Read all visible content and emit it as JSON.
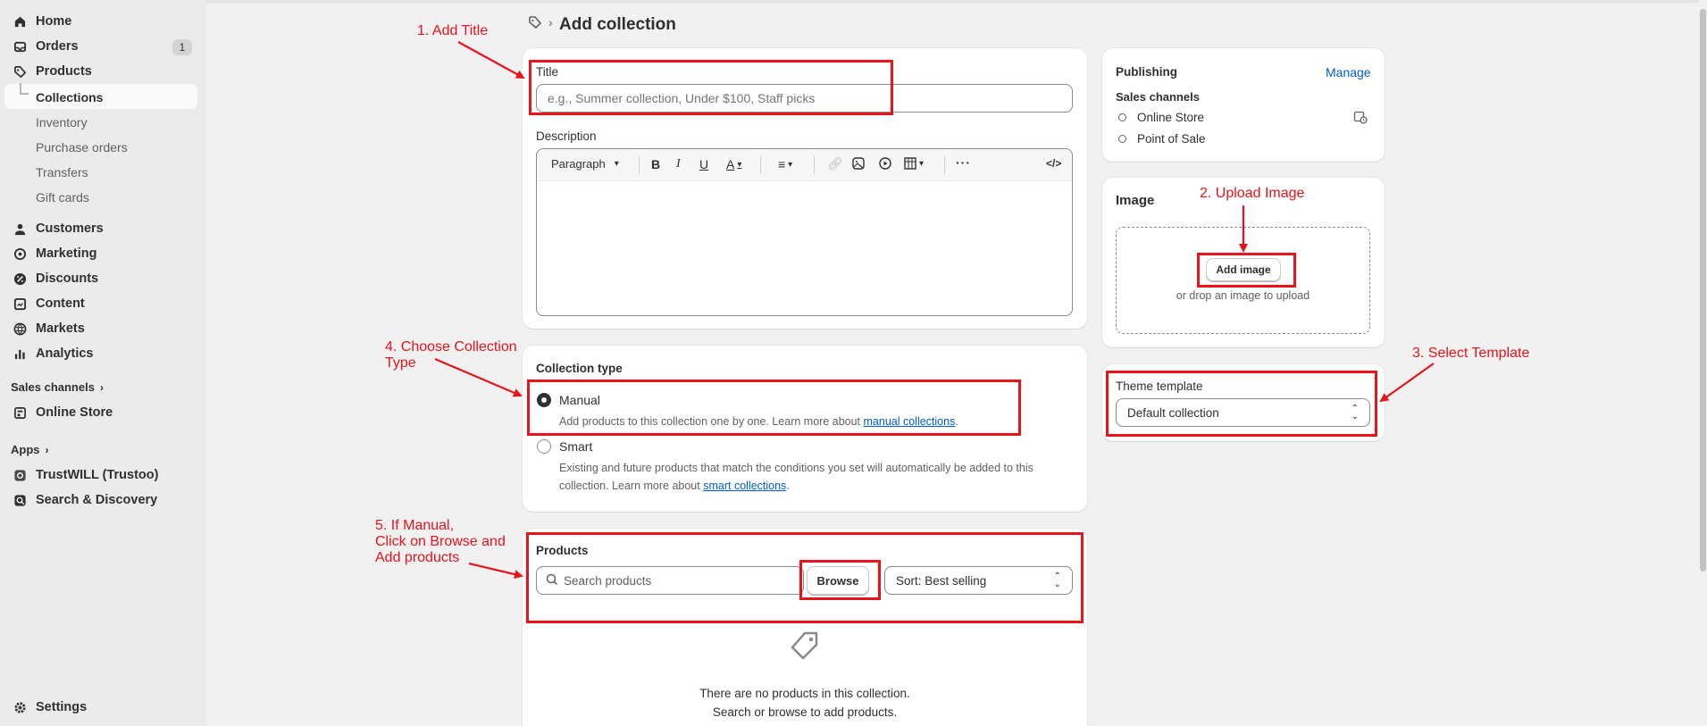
{
  "sidebar": {
    "items": [
      {
        "label": "Home",
        "icon": "home-icon"
      },
      {
        "label": "Orders",
        "icon": "inbox-icon",
        "badge": "1"
      },
      {
        "label": "Products",
        "icon": "tag-icon"
      },
      {
        "label": "Customers",
        "icon": "person-icon"
      },
      {
        "label": "Marketing",
        "icon": "target-icon"
      },
      {
        "label": "Discounts",
        "icon": "discount-icon"
      },
      {
        "label": "Content",
        "icon": "content-icon"
      },
      {
        "label": "Markets",
        "icon": "globe-icon"
      },
      {
        "label": "Analytics",
        "icon": "bar-chart-icon"
      }
    ],
    "product_subitems": [
      "Collections",
      "Inventory",
      "Purchase orders",
      "Transfers",
      "Gift cards"
    ],
    "sales_channels_heading": "Sales channels",
    "online_store": "Online Store",
    "apps_heading": "Apps",
    "apps": [
      "TrustWILL (Trustoo)",
      "Search & Discovery"
    ],
    "settings": "Settings"
  },
  "header": {
    "title": "Add collection",
    "breadcrumb_icon": "tag-icon"
  },
  "title_card": {
    "title_label": "Title",
    "title_placeholder": "e.g., Summer collection, Under $100, Staff picks",
    "description_label": "Description",
    "paragraph_select": "Paragraph"
  },
  "collection_type": {
    "heading": "Collection type",
    "manual_label": "Manual",
    "manual_desc": "Add products to this collection one by one. Learn more about ",
    "manual_link": "manual collections",
    "smart_label": "Smart",
    "smart_desc_1": "Existing and future products that match the conditions you set will automatically be added to this",
    "smart_desc_2": "collection. Learn more about ",
    "smart_link": "smart collections",
    "period": "."
  },
  "products": {
    "heading": "Products",
    "search_placeholder": "Search products",
    "browse": "Browse",
    "sort": "Sort: Best selling",
    "empty_1": "There are no products in this collection.",
    "empty_2": "Search or browse to add products."
  },
  "publishing": {
    "heading": "Publishing",
    "manage": "Manage",
    "sales_channels": "Sales channels",
    "channels": [
      "Online Store",
      "Point of Sale"
    ]
  },
  "image_card": {
    "heading": "Image",
    "add_image": "Add image",
    "drop_text": "or drop an image to upload"
  },
  "theme": {
    "label": "Theme template",
    "value": "Default collection"
  },
  "annotations": {
    "a1": "1. Add Title",
    "a2": "2. Upload Image",
    "a3": "3. Select Template",
    "a4_1": "4. Choose Collection",
    "a4_2": "Type",
    "a5_1": "5. If Manual,",
    "a5_2": "Click on Browse and",
    "a5_3": "Add products"
  },
  "colors": {
    "annotation": "#e8131b",
    "link": "#005bd3",
    "sidebar": "#ebebeb"
  }
}
